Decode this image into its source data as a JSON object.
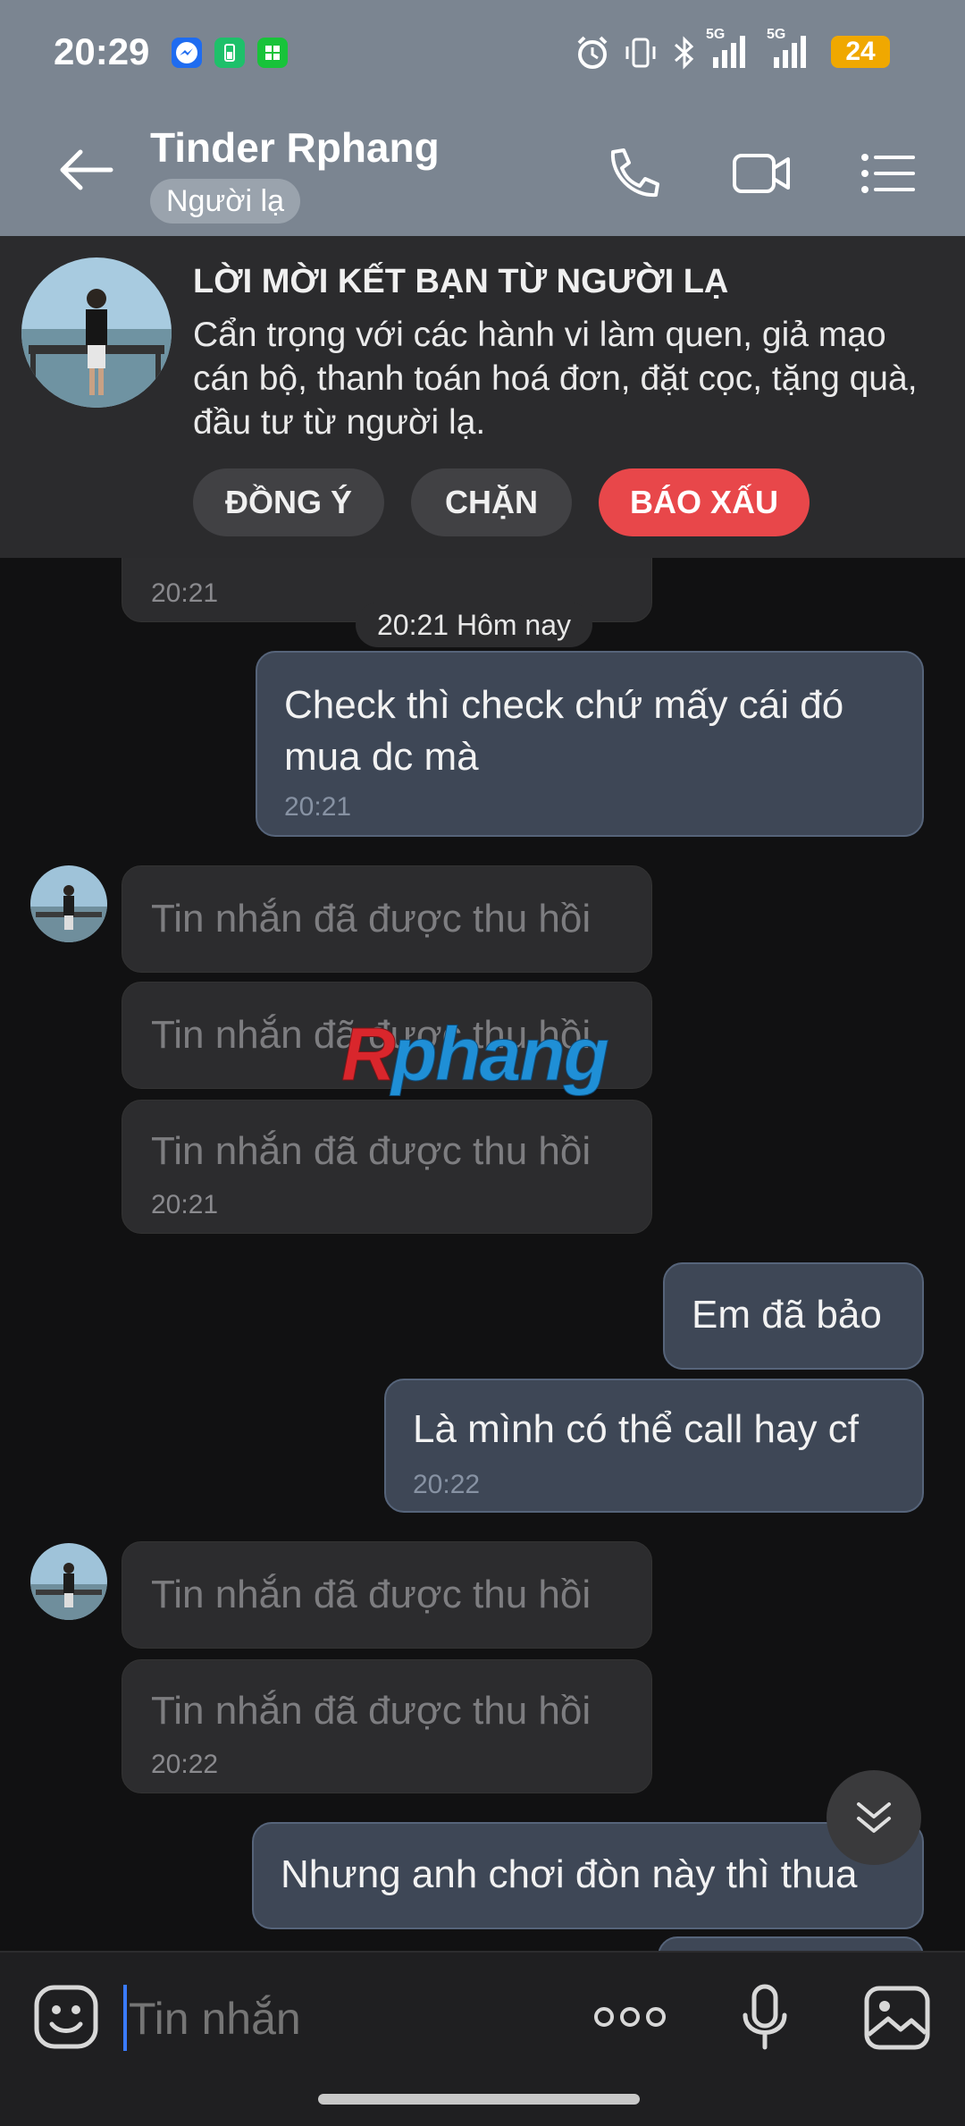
{
  "status_bar": {
    "time": "20:29",
    "battery": "24",
    "signal_1": "5G",
    "signal_2": "5G"
  },
  "header": {
    "title": "Tinder Rphang",
    "tag": "Người lạ"
  },
  "request_card": {
    "title": "LỜI MỜI KẾT BẠN TỪ NGƯỜI LẠ",
    "body": "Cẩn trọng với các hành vi làm quen, giả mạo cán bộ, thanh toán hoá đơn, đặt cọc, tặng quà, đầu tư từ người lạ.",
    "accept_label": "ĐỒNG Ý",
    "block_label": "CHẶN",
    "report_label": "BÁO XẤU"
  },
  "date_divider": "20:21 Hôm nay",
  "messages": [
    {
      "dir": "in",
      "text": "",
      "time": "20:21"
    },
    {
      "dir": "out",
      "text": "Check thì check chứ mấy cái đó mua dc mà",
      "time": "20:21"
    },
    {
      "dir": "in",
      "text": "Tin nhắn đã được thu hồi",
      "time": ""
    },
    {
      "dir": "in",
      "text": "Tin nhắn đã được thu hồi",
      "time": ""
    },
    {
      "dir": "in",
      "text": "Tin nhắn đã được thu hồi",
      "time": "20:21"
    },
    {
      "dir": "out",
      "text": "Em đã bảo",
      "time": ""
    },
    {
      "dir": "out",
      "text": "Là mình có thể call hay cf",
      "time": "20:22"
    },
    {
      "dir": "in",
      "text": "Tin nhắn đã được thu hồi",
      "time": ""
    },
    {
      "dir": "in",
      "text": "Tin nhắn đã được thu hồi",
      "time": "20:22"
    },
    {
      "dir": "out",
      "text": "Nhưng anh chơi đòn này thì thua",
      "time": ""
    }
  ],
  "watermark": "Rphang",
  "composer": {
    "placeholder": "Tin nhắn"
  },
  "colors": {
    "header_bg": "#7b8591",
    "report_red": "#e8474a",
    "bubble_out": "#3e4756",
    "bubble_in": "#2c2c2e"
  }
}
